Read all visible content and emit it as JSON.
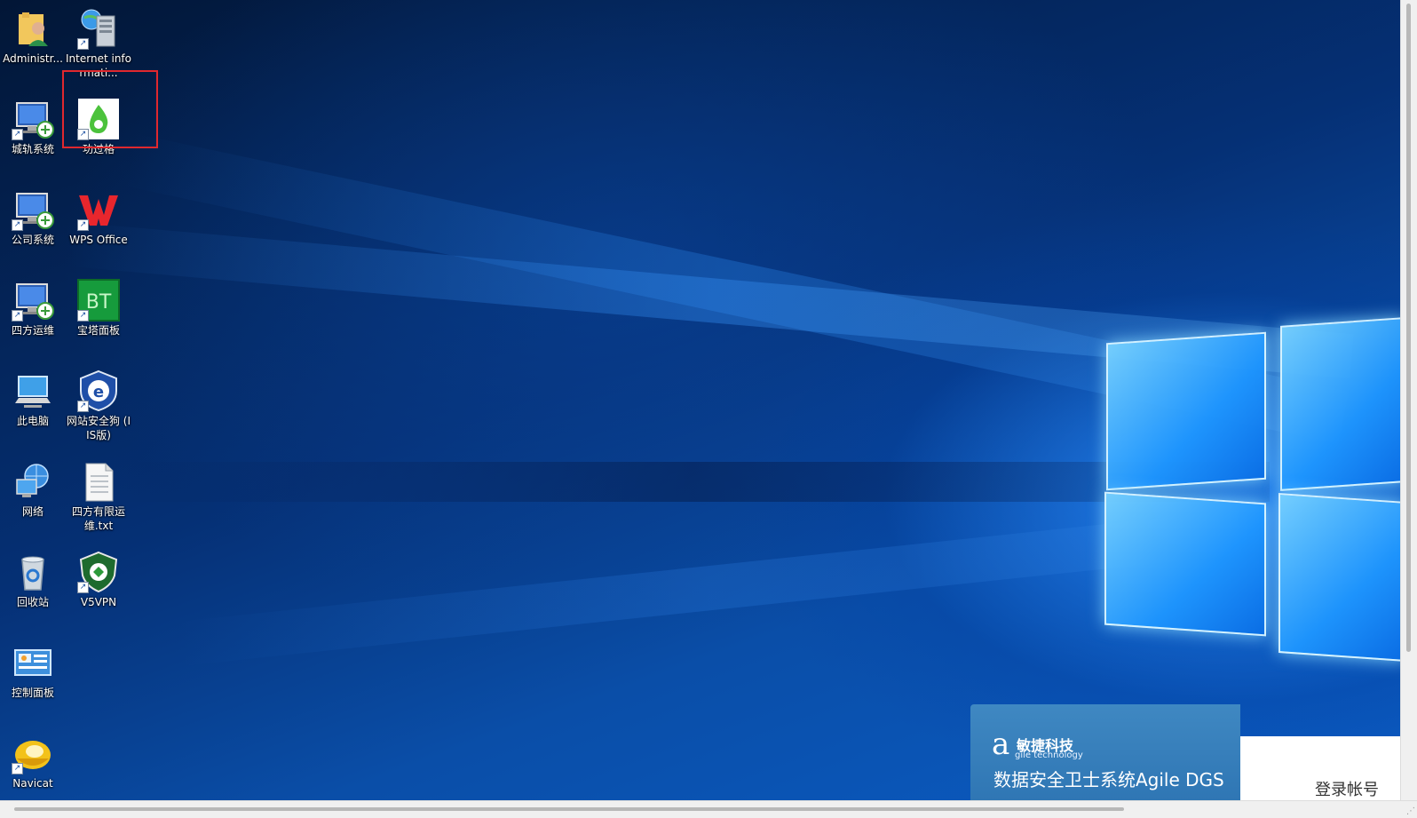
{
  "desktop": {
    "icons": [
      {
        "label": "Administr...",
        "icon": "user-folder-icon"
      },
      {
        "label": "Internet informati...",
        "icon": "iis-server-icon"
      },
      {
        "label": "城轨系统",
        "icon": "remote-desktop-icon"
      },
      {
        "label": "功过格",
        "icon": "green-drop-app-icon"
      },
      {
        "label": "公司系统",
        "icon": "remote-desktop-icon"
      },
      {
        "label": "WPS Office",
        "icon": "wps-office-icon"
      },
      {
        "label": "四方运维",
        "icon": "remote-desktop-icon"
      },
      {
        "label": "宝塔面板",
        "icon": "bt-panel-icon"
      },
      {
        "label": "此电脑",
        "icon": "this-pc-icon"
      },
      {
        "label": "网站安全狗 (IIS版)",
        "icon": "safedog-shield-icon"
      },
      {
        "label": "网络",
        "icon": "network-icon"
      },
      {
        "label": "四方有限运维.txt",
        "icon": "text-file-icon"
      },
      {
        "label": "回收站",
        "icon": "recycle-bin-icon"
      },
      {
        "label": "V5VPN",
        "icon": "v5vpn-shield-icon"
      },
      {
        "label": "控制面板",
        "icon": "control-panel-icon"
      },
      {
        "label": "Navicat",
        "icon": "navicat-icon"
      }
    ]
  },
  "popup": {
    "brand_letter": "a",
    "brand_name": "敏捷科技",
    "brand_sub": "gile technology",
    "product_title": "数据安全卫士系统Agile DGS",
    "login_label": "登录帐号"
  },
  "colors": {
    "highlight": "#e0282e",
    "popup_blue": "#3a82be"
  }
}
